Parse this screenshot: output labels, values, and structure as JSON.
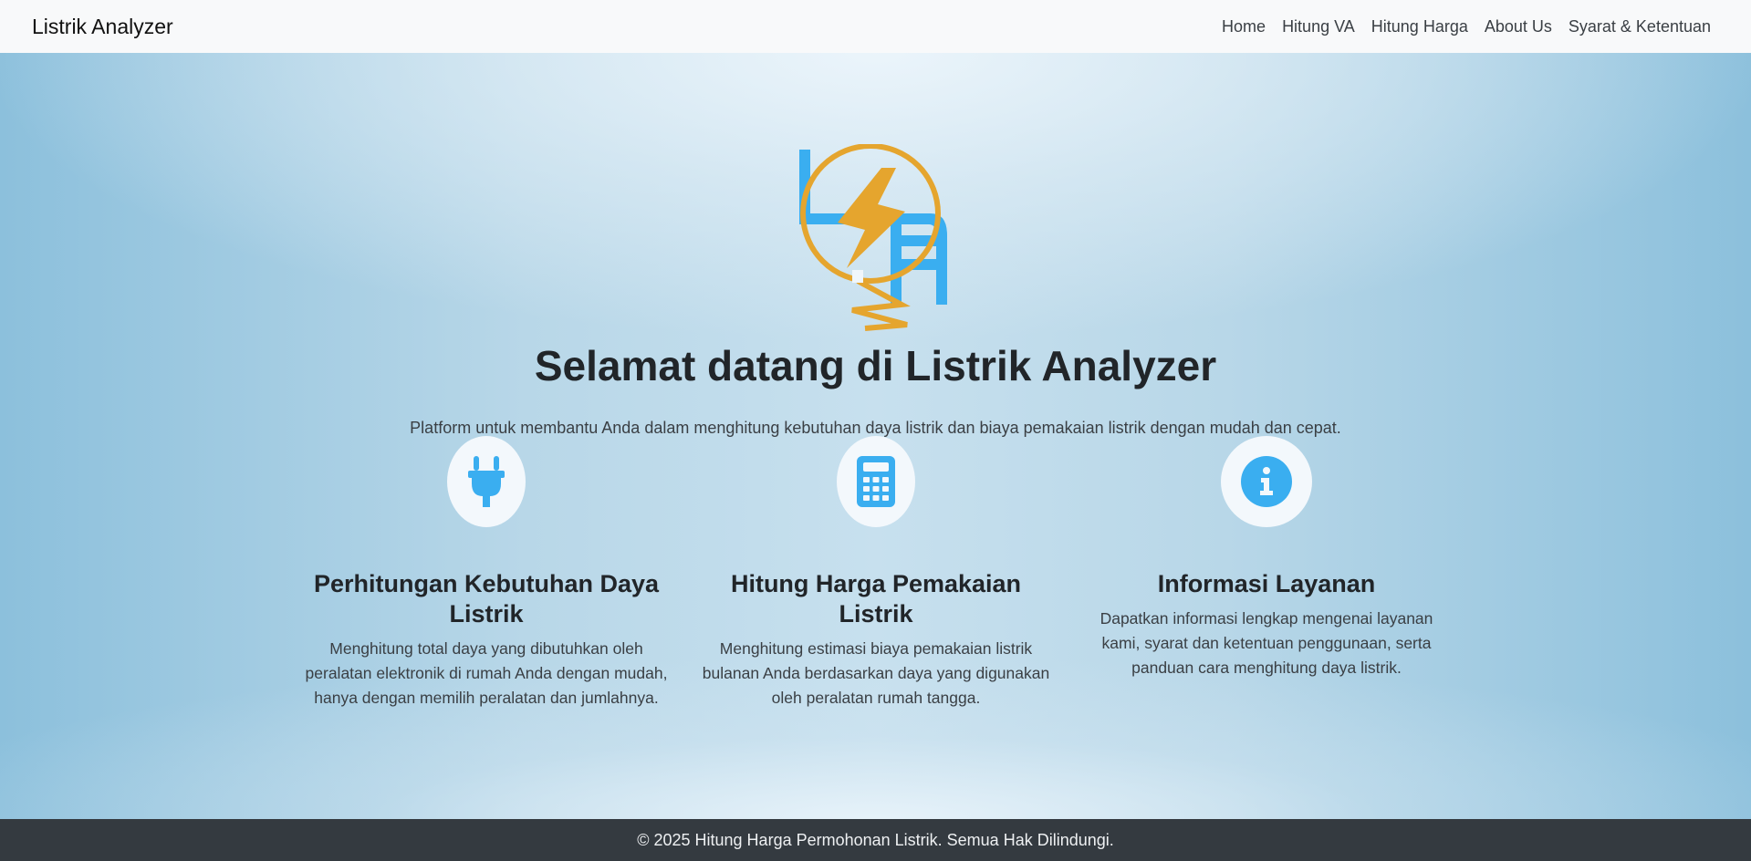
{
  "navbar": {
    "brand": "Listrik Analyzer",
    "links": [
      "Home",
      "Hitung VA",
      "Hitung Harga",
      "About Us",
      "Syarat & Ketentuan"
    ]
  },
  "hero": {
    "logo_icon": "listrik-analyzer-logo",
    "title": "Selamat datang di Listrik Analyzer",
    "subtitle": "Platform untuk membantu Anda dalam menghitung kebutuhan daya listrik dan biaya pemakaian listrik dengan mudah dan cepat."
  },
  "features": [
    {
      "icon": "plug-icon",
      "title": "Perhitungan Kebutuhan Daya Listrik",
      "description": "Menghitung total daya yang dibutuhkan oleh peralatan elektronik di rumah Anda dengan mudah, hanya dengan memilih peralatan dan jumlahnya."
    },
    {
      "icon": "calculator-icon",
      "title": "Hitung Harga Pemakaian Listrik",
      "description": "Menghitung estimasi biaya pemakaian listrik bulanan Anda berdasarkan daya yang digunakan oleh peralatan rumah tangga."
    },
    {
      "icon": "info-icon",
      "title": "Informasi Layanan",
      "description": "Dapatkan informasi lengkap mengenai layanan kami, syarat dan ketentuan penggunaan, serta panduan cara menghitung daya listrik."
    }
  ],
  "footer": {
    "text": "© 2025 Hitung Harga Permohonan Listrik. Semua Hak Dilindungi."
  },
  "colors": {
    "accent_blue": "#3aaef0",
    "logo_orange": "#e5a52e",
    "footer_bg": "#343a40",
    "navbar_bg": "#f8f9fa"
  }
}
